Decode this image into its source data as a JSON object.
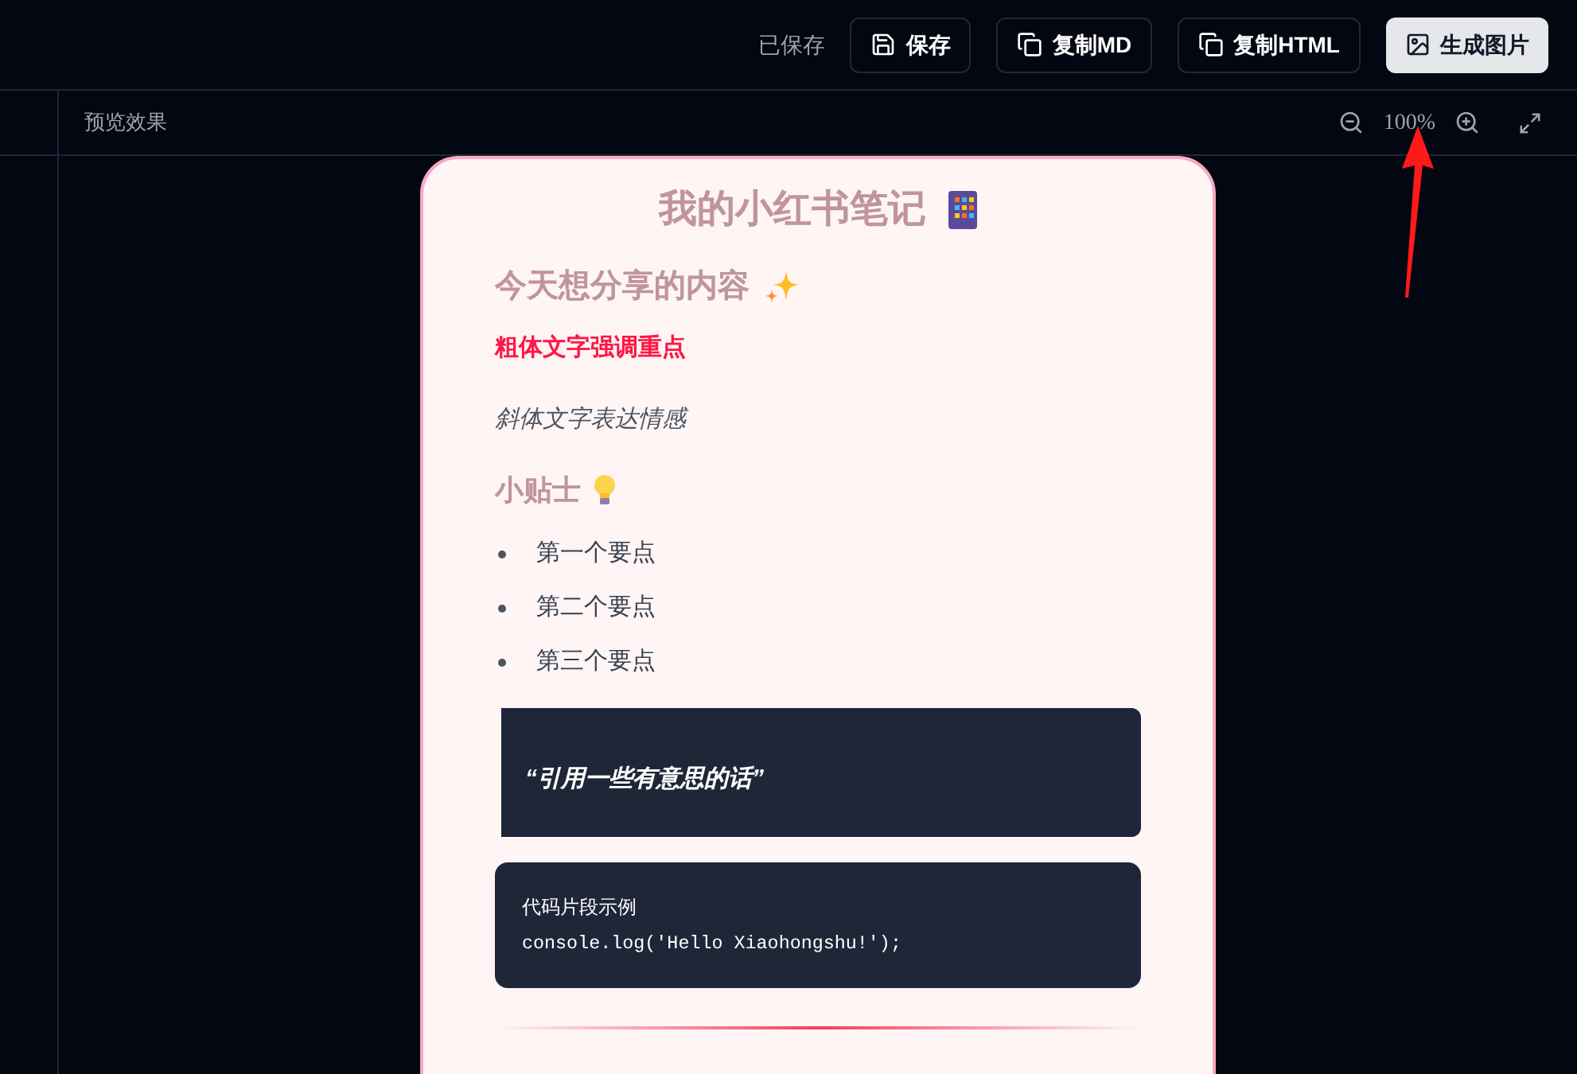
{
  "toolbar": {
    "status": "已保存",
    "buttons": [
      {
        "label": "保存",
        "kind": "outline"
      },
      {
        "label": "复制MD",
        "kind": "outline"
      },
      {
        "label": "复制HTML",
        "kind": "outline"
      },
      {
        "label": "生成图片",
        "kind": "filled"
      }
    ]
  },
  "preview_bar": {
    "title": "预览效果",
    "zoom": "100%"
  },
  "note_card": {
    "title": "我的小红书笔记",
    "blocks": [
      {
        "kind": "heading",
        "text": "今天想分享的内容"
      },
      {
        "kind": "bold",
        "text": "粗体文字强调重点"
      },
      {
        "kind": "italic",
        "text": "斜体文字表达情感"
      },
      {
        "kind": "subheading",
        "text": "小贴士"
      },
      {
        "kind": "list",
        "items": [
          "第一个要点",
          "第二个要点",
          "第三个要点"
        ]
      },
      {
        "kind": "quote",
        "text": "“引用一些有意思的话”"
      },
      {
        "kind": "code",
        "label": "代码片段示例",
        "code": "console.log('Hello Xiaohongshu!');"
      },
      {
        "kind": "divider"
      }
    ]
  }
}
